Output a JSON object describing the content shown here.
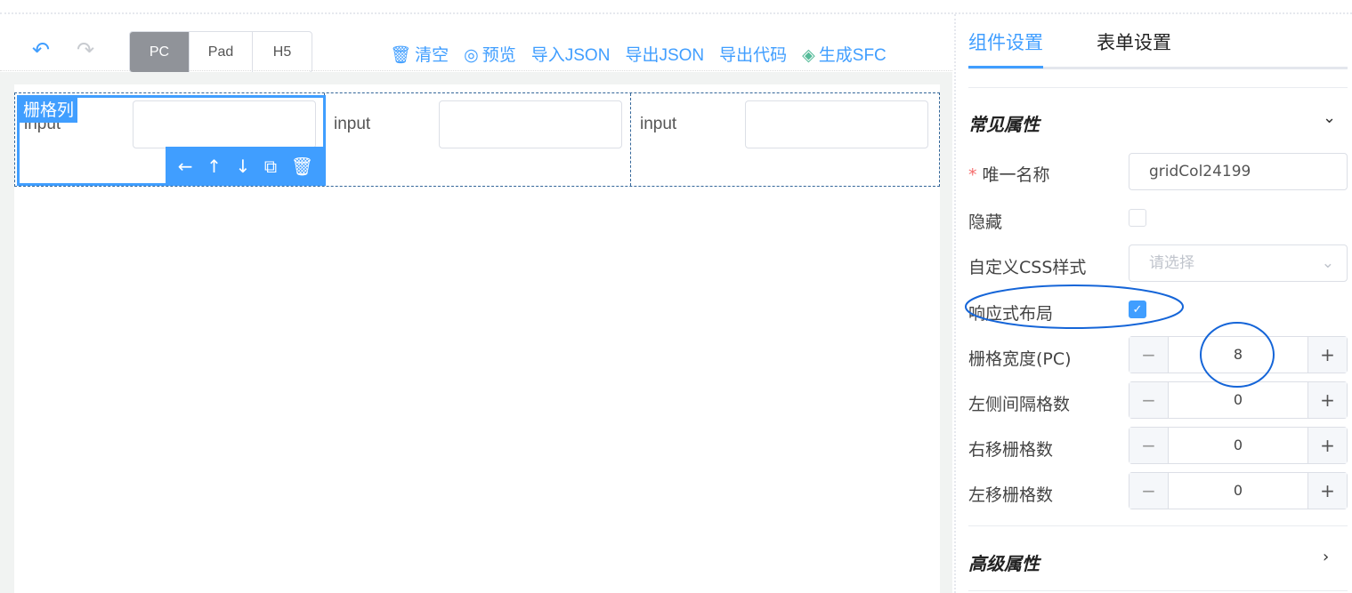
{
  "toolbar": {
    "undo_icon": "undo-icon",
    "redo_icon": "redo-icon",
    "devices": [
      "PC",
      "Pad",
      "H5"
    ],
    "active_device": "PC",
    "actions": [
      {
        "icon": "trash-icon",
        "glyph": "🗑",
        "label": "清空"
      },
      {
        "icon": "eye-icon",
        "glyph": "◎",
        "label": "预览"
      },
      {
        "label": "导入JSON"
      },
      {
        "label": "导出JSON"
      },
      {
        "label": "导出代码"
      },
      {
        "icon": "layers-icon",
        "glyph": "◈",
        "label": "生成SFC"
      }
    ]
  },
  "canvas": {
    "selected_tag": "栅格列",
    "columns": [
      {
        "label": "input"
      },
      {
        "label": "input"
      },
      {
        "label": "input"
      }
    ],
    "tools": [
      "←",
      "↑",
      "↓",
      "⧉",
      "🗑"
    ]
  },
  "panel": {
    "tabs": [
      "组件设置",
      "表单设置"
    ],
    "active_tab": "组件设置",
    "common_section": "常见属性",
    "advanced_section": "高级属性",
    "fields": {
      "name_label": "唯一名称",
      "name_value": "gridCol24199",
      "hidden_label": "隐藏",
      "hidden_checked": false,
      "css_label": "自定义CSS样式",
      "css_placeholder": "请选择",
      "responsive_label": "响应式布局",
      "responsive_checked": true,
      "span_label": "栅格宽度(PC)",
      "span_value": "8",
      "offset_label": "左侧间隔格数",
      "offset_value": "0",
      "push_label": "右移栅格数",
      "push_value": "0",
      "pull_label": "左移栅格数",
      "pull_value": "0"
    }
  },
  "colors": {
    "accent": "#409eff",
    "annotation": "#1565d8"
  }
}
